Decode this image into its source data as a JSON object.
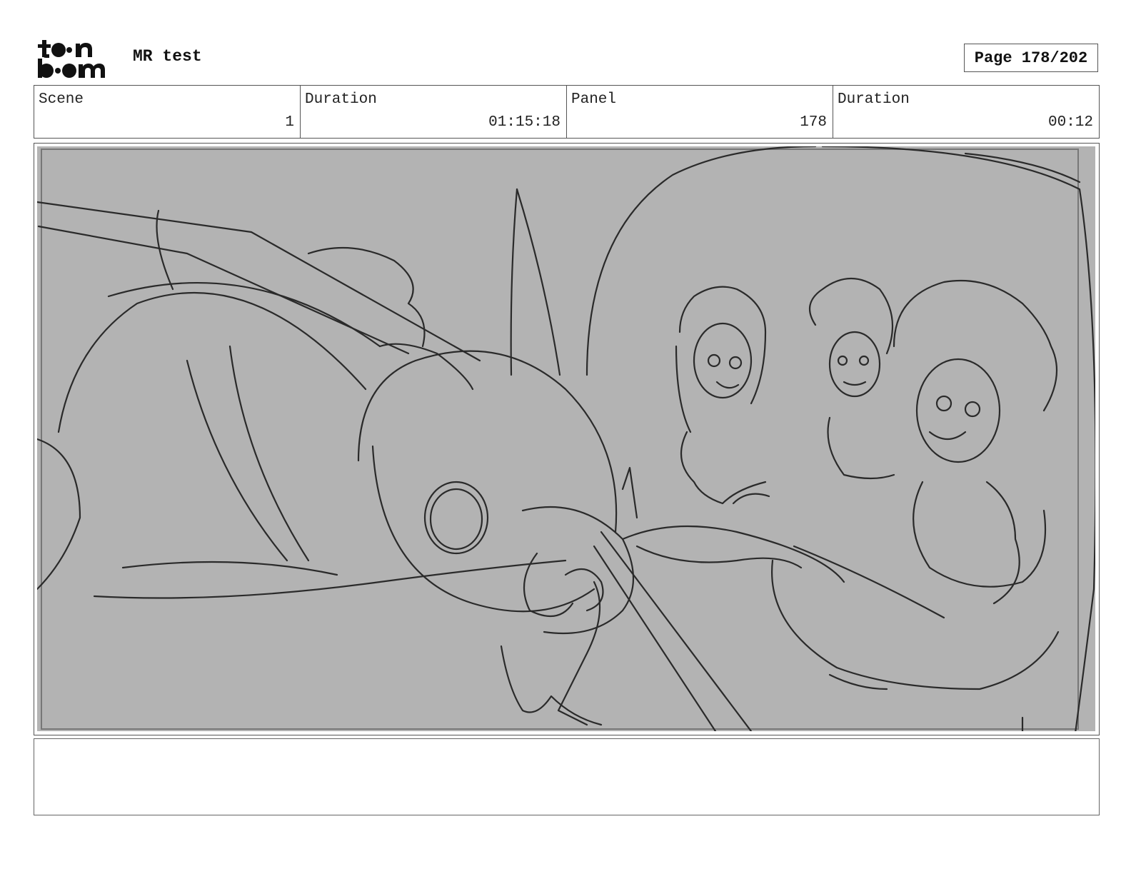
{
  "header": {
    "logo_text": "toon boom",
    "project_title": "MR test",
    "page_label": "Page 178/202"
  },
  "info": {
    "scene_label": "Scene",
    "scene_value": "1",
    "scene_duration_label": "Duration",
    "scene_duration_value": "01:15:18",
    "panel_label": "Panel",
    "panel_value": "178",
    "panel_duration_label": "Duration",
    "panel_duration_value": "00:12"
  },
  "notes": {
    "text": ""
  },
  "colors": {
    "panel_background": "#b3b3b3",
    "sketch_line": "#2a2a2a"
  }
}
